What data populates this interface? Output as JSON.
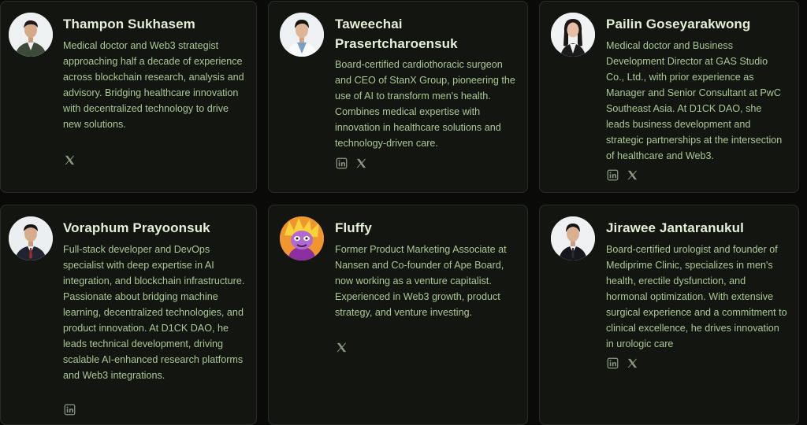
{
  "colors": {
    "background": "#0a0b09",
    "card": "#131511",
    "name": "#e3f0d6",
    "bio": "#a9c992",
    "icon": "#8a9a80"
  },
  "team": [
    {
      "name": "Thampon Sukhasem",
      "bio": "Medical doctor and Web3 strategist approaching half a decade of experience across blockchain research, analysis and advisory. Bridging healthcare innovation with decentralized technology to drive new solutions.",
      "socials": [
        "x-icon"
      ]
    },
    {
      "name": "Taweechai Prasertcharoensuk",
      "bio": "Board-certified cardiothoracic surgeon and CEO of StanX Group, pioneering the use of AI to transform men's health. Combines medical expertise with innovation in healthcare solutions and technology-driven care.",
      "socials": [
        "linkedin-icon",
        "x-icon"
      ]
    },
    {
      "name": "Pailin Goseyarakwong",
      "bio": "Medical doctor and Business Development Director at GAS Studio Co., Ltd., with prior experience as Manager and Senior Consultant at PwC Southeast Asia. At D1CK DAO, she leads business development and strategic partnerships at the intersection of healthcare and Web3.",
      "socials": [
        "linkedin-icon",
        "x-icon"
      ]
    },
    {
      "name": "Voraphum Prayoonsuk",
      "bio": "Full-stack developer and DevOps specialist with deep expertise in AI integration, and blockchain infrastructure. Passionate about bridging machine learning, decentralized technologies, and product innovation. At D1CK DAO, he leads technical development, driving scalable AI-enhanced research platforms and Web3 integrations.",
      "socials": [
        "linkedin-icon"
      ]
    },
    {
      "name": "Fluffy",
      "bio": "Former Product Marketing Associate at Nansen and Co-founder of Ape Board, now working as a venture capitalist. Experienced in Web3 growth, product strategy, and venture investing.",
      "socials": [
        "x-icon"
      ]
    },
    {
      "name": "Jirawee Jantaranukul",
      "bio": "Board-certified urologist and founder of Mediprime Clinic, specializes in men's health, erectile dysfunction, and hormonal optimization. With extensive surgical experience and a commitment to clinical excellence, he drives innovation in urologic care",
      "socials": [
        "linkedin-icon",
        "x-icon"
      ]
    }
  ]
}
